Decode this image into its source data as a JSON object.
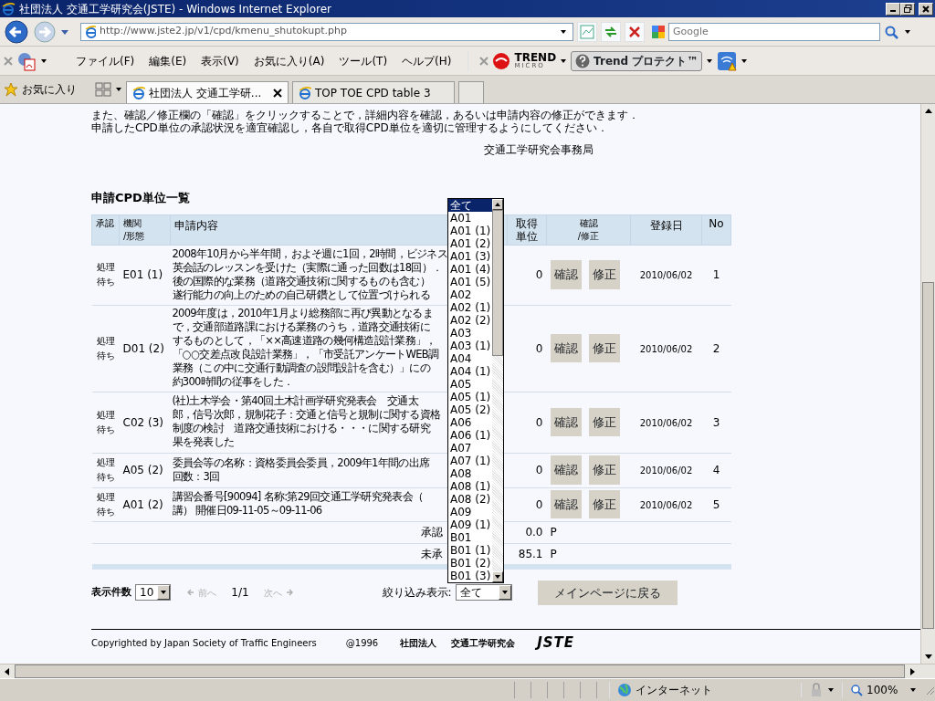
{
  "window": {
    "title": "社団法人 交通工学研究会(JSTE) - Windows Internet Explorer"
  },
  "address_bar": {
    "url": "http://www.jste2.jp/v1/cpd/kmenu_shutokupt.php"
  },
  "search": {
    "placeholder": "Google"
  },
  "menu": [
    "ファイル(F)",
    "編集(E)",
    "表示(V)",
    "お気に入り(A)",
    "ツール(T)",
    "ヘルプ(H)"
  ],
  "toolbar": {
    "trend_logo": "TREND",
    "trend_logo_sub": "MICRO",
    "protect_button": "Trend プロテクト™"
  },
  "favorites": {
    "label": "お気に入り"
  },
  "tabs": [
    {
      "label": "社団法人 交通工学研...",
      "selected": true
    },
    {
      "label": "TOP TOE CPD table 3",
      "selected": false
    }
  ],
  "page": {
    "intro": "また、確認／修正欄の「確認」をクリックすることで，詳細内容を確認，あるいは申請内容の修正ができます．",
    "intro2": "申請したCPD単位の承認状況を適宜確認し，各自で取得CPD単位を適切に管理するようにしてください．",
    "signature": "交通工学研究会事務局",
    "section_title": "申請CPD単位一覧",
    "table": {
      "columns": [
        [
          "承認"
        ],
        [
          "機関",
          "/形態"
        ],
        [
          "申請内容"
        ],
        [
          "取得",
          "単位"
        ],
        [
          "確認",
          "/修正"
        ],
        [
          "登録日"
        ],
        [
          "No"
        ]
      ],
      "rows": [
        {
          "status": [
            "処理",
            "待ち"
          ],
          "code": "E01 (1)",
          "content": [
            "2008年10月から半年間，およそ週に1回，2時間，ビジネス",
            "英会話のレッスンを受けた（実際に通った回数は18回）．",
            "後の国際的な業務（道路交通技術に関するものも含む）",
            "遂行能力の向上のための自己研鑽として位置づけられる"
          ],
          "units": "0",
          "confirm": "確認",
          "edit": "修正",
          "date": "2010/06/02",
          "no": "1"
        },
        {
          "status": [
            "処理",
            "待ち"
          ],
          "code": "D01 (2)",
          "content": [
            "2009年度は，2010年1月より総務部に再び異動となるま",
            "で，交通部道路課における業務のうち，道路交通技術に",
            "するものとして，「××高速道路の幾何構造設計業務」，",
            "「○○交差点改良設計業務」，「市受託アンケートWEB調",
            "業務（この中に交通行動調査の設問設計を含む）」にの",
            "約300時間の従事をした．"
          ],
          "units": "0",
          "confirm": "確認",
          "edit": "修正",
          "date": "2010/06/02",
          "no": "2"
        },
        {
          "status": [
            "処理",
            "待ち"
          ],
          "code": "C02 (3)",
          "content": [
            "(社)土木学会・第40回土木計画学研究発表会　交通太",
            "郎，信号次郎，規制花子：交通と信号と規制に関する資格",
            "制度の検討　道路交通技術における・・・に関する研究",
            "果を発表した"
          ],
          "units": "0",
          "confirm": "確認",
          "edit": "修正",
          "date": "2010/06/02",
          "no": "3"
        },
        {
          "status": [
            "処理",
            "待ち"
          ],
          "code": "A05 (2)",
          "content": [
            "委員会等の名称：資格委員会委員，2009年1年間の出席",
            "回数：3回"
          ],
          "units": "0",
          "confirm": "確認",
          "edit": "修正",
          "date": "2010/06/02",
          "no": "4"
        },
        {
          "status": [
            "処理",
            "待ち"
          ],
          "code": "A01 (2)",
          "content": [
            "講習会番号[90094] 名称:第29回交通工学研究発表会（",
            "講） 開催日09-11-05～09-11-06"
          ],
          "units": "0",
          "confirm": "確認",
          "edit": "修正",
          "date": "2010/06/02",
          "no": "5"
        }
      ],
      "summary": [
        {
          "label": "承認",
          "value": "0.0",
          "unit": "P"
        },
        {
          "label": "未承",
          "value": "85.1",
          "unit": "P"
        }
      ]
    },
    "pager": {
      "label": "表示件数",
      "per_page": "10",
      "prev": "前へ",
      "prev_disabled": true,
      "position": "1/1",
      "next": "次へ",
      "next_disabled": true
    },
    "filter": {
      "label": "絞り込み表示:",
      "value": "全て",
      "open": true,
      "options": [
        {
          "label": "全て",
          "selected": true
        },
        {
          "label": "A01",
          "selected": false
        },
        {
          "label": "A01 (1)",
          "selected": false
        },
        {
          "label": "A01 (2)",
          "selected": false
        },
        {
          "label": "A01 (3)",
          "selected": false
        },
        {
          "label": "A01 (4)",
          "selected": false
        },
        {
          "label": "A01 (5)",
          "selected": false
        },
        {
          "label": "A02",
          "selected": false
        },
        {
          "label": "A02 (1)",
          "selected": false
        },
        {
          "label": "A02 (2)",
          "selected": false
        },
        {
          "label": "A03",
          "selected": false
        },
        {
          "label": "A03 (1)",
          "selected": false
        },
        {
          "label": "A04",
          "selected": false
        },
        {
          "label": "A04 (1)",
          "selected": false
        },
        {
          "label": "A05",
          "selected": false
        },
        {
          "label": "A05 (1)",
          "selected": false
        },
        {
          "label": "A05 (2)",
          "selected": false
        },
        {
          "label": "A06",
          "selected": false
        },
        {
          "label": "A06 (1)",
          "selected": false
        },
        {
          "label": "A07",
          "selected": false
        },
        {
          "label": "A07 (1)",
          "selected": false
        },
        {
          "label": "A08",
          "selected": false
        },
        {
          "label": "A08 (1)",
          "selected": false
        },
        {
          "label": "A08 (2)",
          "selected": false
        },
        {
          "label": "A09",
          "selected": false
        },
        {
          "label": "A09 (1)",
          "selected": false
        },
        {
          "label": "B01",
          "selected": false
        },
        {
          "label": "B01 (1)",
          "selected": false
        },
        {
          "label": "B01 (2)",
          "selected": false
        },
        {
          "label": "B01 (3)",
          "selected": false
        }
      ]
    },
    "back_button": "メインページに戻る",
    "footer": {
      "copyright": "Copyrighted by Japan Society of Traffic Engineers",
      "year": "@1996",
      "org_type": "社団法人",
      "org_name": "交通工学研究会",
      "logo": "JSTE"
    }
  },
  "status_bar": {
    "zone": "インターネット",
    "zoom": "100%"
  }
}
